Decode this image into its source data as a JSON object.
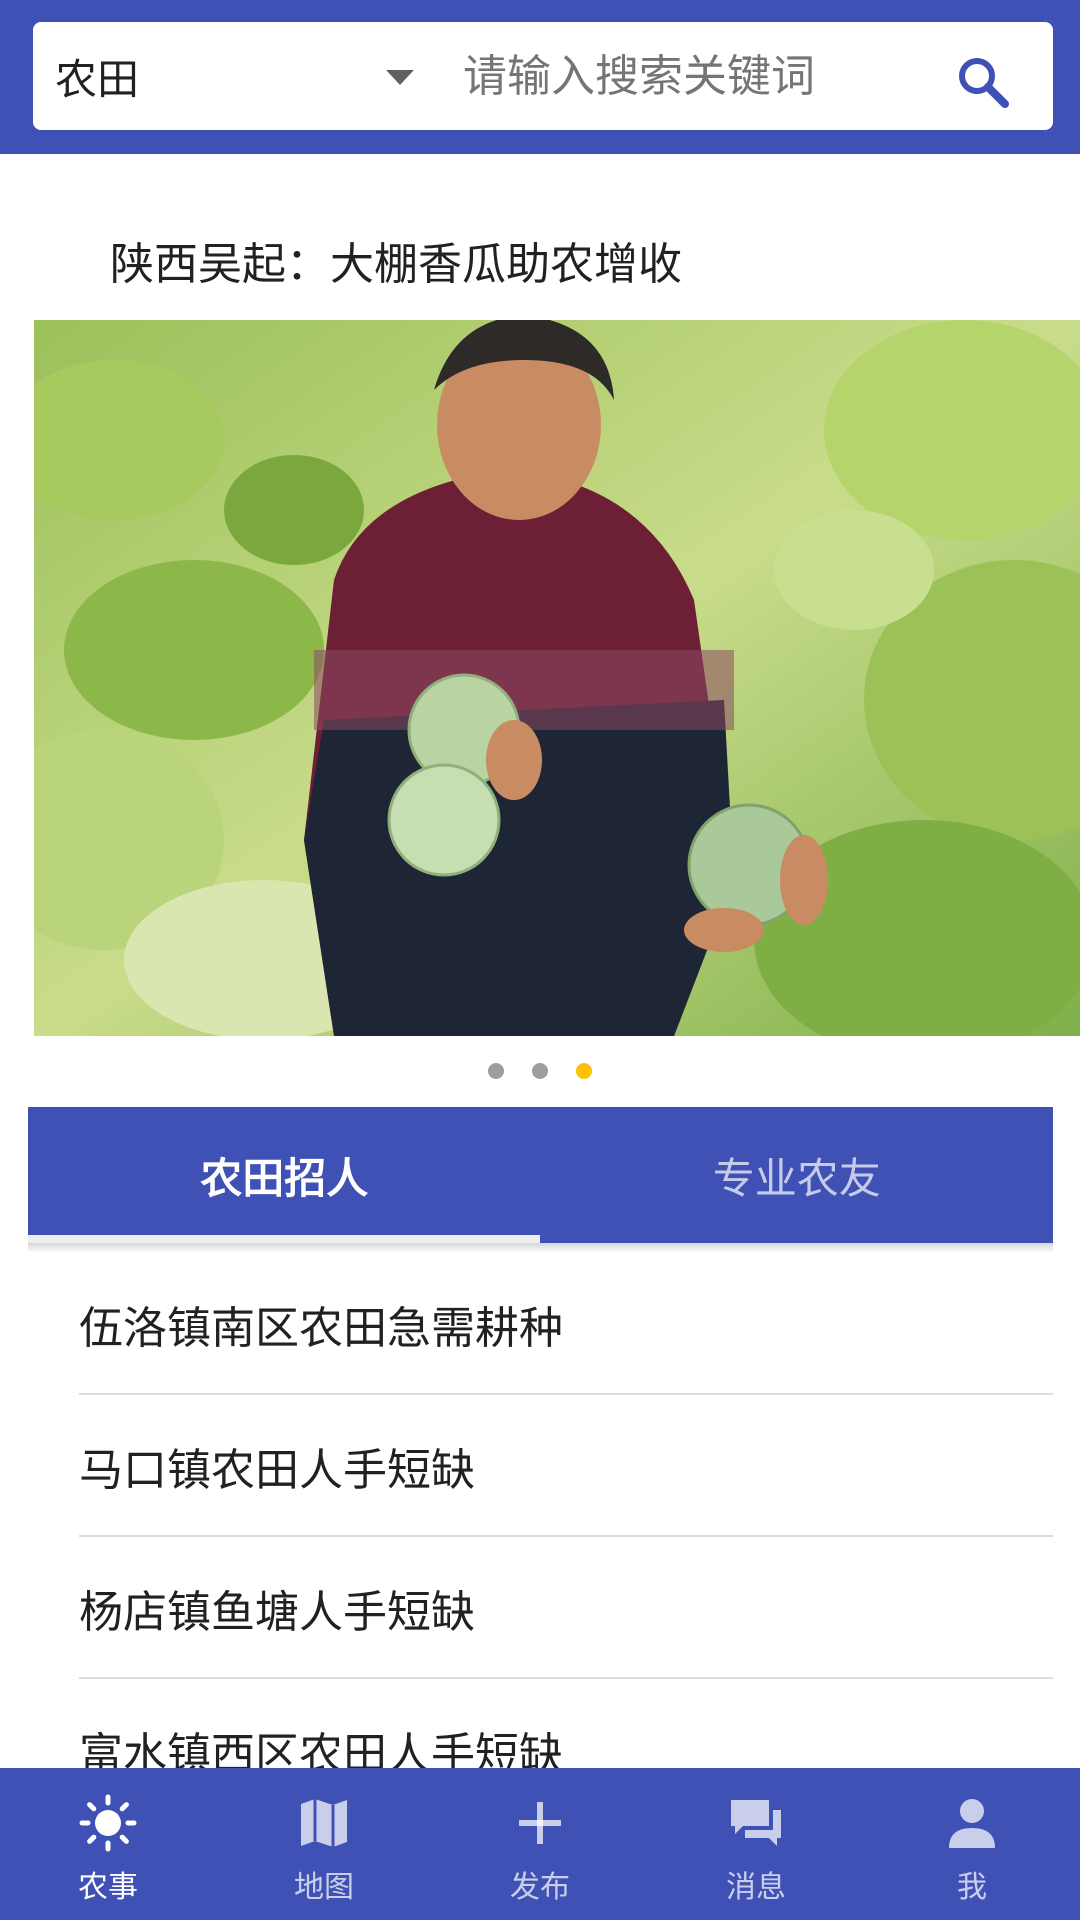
{
  "search": {
    "category": "农田",
    "placeholder": "请输入搜索关键词"
  },
  "headline": "陕西吴起：大棚香瓜助农增收",
  "carousel": {
    "slide_count": 3,
    "active_index": 2
  },
  "tabs": [
    {
      "label": "农田招人",
      "active": true
    },
    {
      "label": "专业农友",
      "active": false
    }
  ],
  "list": [
    {
      "title": "伍洛镇南区农田急需耕种"
    },
    {
      "title": "马口镇农田人手短缺"
    },
    {
      "title": "杨店镇鱼塘人手短缺"
    },
    {
      "title": "富水镇西区农田人手短缺"
    }
  ],
  "bottom_nav": [
    {
      "label": "农事",
      "icon": "sun-icon",
      "active": true
    },
    {
      "label": "地图",
      "icon": "map-icon",
      "active": false
    },
    {
      "label": "发布",
      "icon": "plus-icon",
      "active": false
    },
    {
      "label": "消息",
      "icon": "chat-icon",
      "active": false
    },
    {
      "label": "我",
      "icon": "person-icon",
      "active": false
    }
  ],
  "colors": {
    "primary": "#3f51b5",
    "accent_dot": "#ffc107"
  }
}
